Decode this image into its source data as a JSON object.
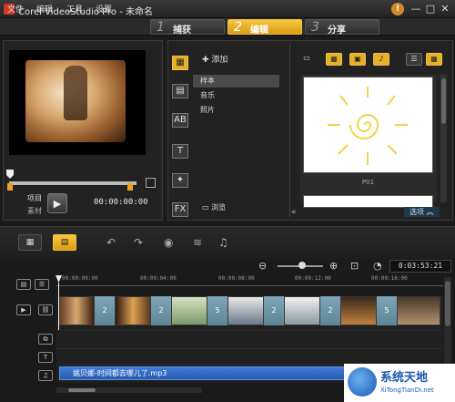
{
  "window": {
    "title": "Corel VideoStudio Pro - 未命名",
    "help_label": "!",
    "min_label": "—",
    "max_label": "□",
    "close_label": "✕"
  },
  "menu": {
    "items": [
      "文件",
      "编辑",
      "工具",
      "设置"
    ]
  },
  "steps": [
    {
      "num": "1",
      "label": "捕获",
      "active": false
    },
    {
      "num": "2",
      "label": "编辑",
      "active": true
    },
    {
      "num": "3",
      "label": "分享",
      "active": false
    }
  ],
  "player": {
    "project_label": "项目",
    "clip_label": "素材",
    "timecode": "00:00:00:00"
  },
  "library": {
    "add_label": "添加",
    "folders": [
      "样本",
      "音乐",
      "照片"
    ],
    "selected_folder": "样本",
    "browse_label": "浏览",
    "thumb_caption": "P01",
    "options_label": "选项"
  },
  "timeline": {
    "project_timecode": "0:03:53:21",
    "ruler_labels": [
      "00:00:00:00",
      "00:00:04:00",
      "00:00:08:00",
      "00:00:12:00",
      "00:00:16:00"
    ],
    "transitions": [
      "2",
      "2",
      "5",
      "2",
      "2",
      "5"
    ],
    "audio_clip": "姚贝娜-时间都去哪儿了.mp3"
  },
  "watermark": {
    "title": "系统天地",
    "url": "XiTongTianDi.net"
  }
}
